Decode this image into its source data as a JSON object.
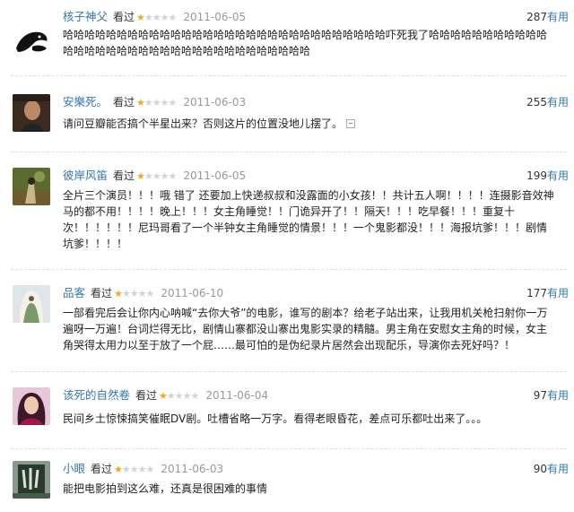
{
  "reviews": [
    {
      "user": "核子神父",
      "status": "看过",
      "rating": 1,
      "date": "2011-06-05",
      "votes": "287",
      "useful": "有用",
      "text": "哈哈哈哈哈哈哈哈哈哈哈哈哈哈哈哈哈哈哈哈哈哈哈哈哈哈哈哈哈哈吓死我了哈哈哈哈哈哈哈哈哈哈哈哈哈哈哈哈哈哈哈哈哈哈哈哈哈哈哈哈哈哈哈哈哈哈"
    },
    {
      "user": "安樂死。",
      "status": "看过",
      "rating": 1,
      "date": "2011-06-03",
      "votes": "255",
      "useful": "有用",
      "text": "请问豆瓣能否搞个半星出来？否则这片的位置没地儿摆了。"
    },
    {
      "user": "彼岸风笛",
      "status": "看过",
      "rating": 1,
      "date": "2011-06-05",
      "votes": "199",
      "useful": "有用",
      "text": "全片三个演员！！！哦 错了 还要加上快递叔叔和没露面的小女孩！！共计五人啊！！！！连摄影音效神马的都不用！！！！晚上！！！女主角睡觉！！门诡异开了！！隔天！！！吃早餐！！！重复十次！！！！！！尼玛哥看了一个半钟女主角睡觉的情景！！！一个鬼影都没！！！海报坑爹！！！剧情坑爹！！！！"
    },
    {
      "user": "品客",
      "status": "看过",
      "rating": 1,
      "date": "2011-06-10",
      "votes": "177",
      "useful": "有用",
      "text": "一部看完后会让你内心呐喊“去你大爷”的电影，谁写的剧本？给老子站出来，让我用机关枪扫射你一万遍呀一万遍！台词烂得无比，剧情山寨都没山寨出鬼影实录的精髓。男主角在安慰女主角的时候，女主角哭得太用力以至于放了一个屁……最可怕的是伪纪录片居然会出现配乐，导演你去死好吗？！"
    },
    {
      "user": "该死的自然卷",
      "status": "看过",
      "rating": 1,
      "date": "2011-06-04",
      "votes": "97",
      "useful": "有用",
      "text": "民间乡土惊悚搞笑催眠DV剧。吐槽省略一万字。看得老眼昏花，差点可乐都吐出来了。。。"
    },
    {
      "user": "小眼",
      "status": "看过",
      "rating": 1,
      "date": "2011-06-03",
      "votes": "90",
      "useful": "有用",
      "text": "能把电影拍到这么难，还真是很困难的事情"
    }
  ],
  "icons": {
    "more": "expand-icon",
    "star": "rating-star-icon"
  },
  "colors": {
    "link": "#3377aa",
    "star": "#f5a623",
    "date": "#999999"
  }
}
